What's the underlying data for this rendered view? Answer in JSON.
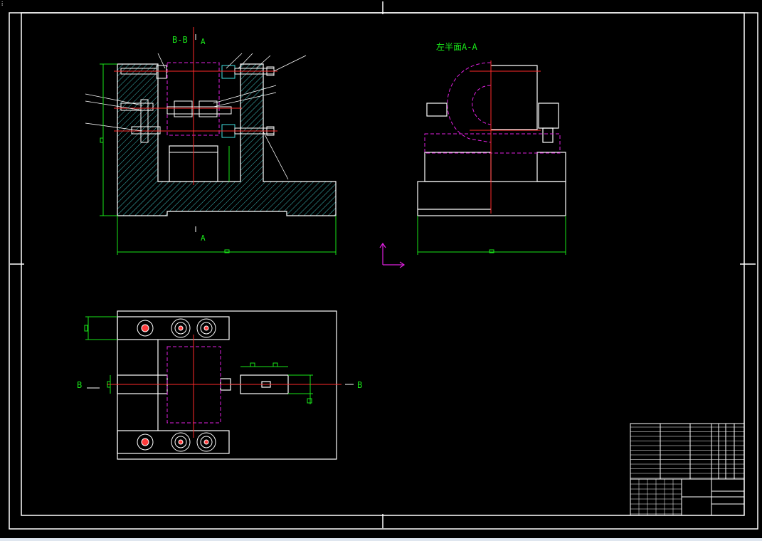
{
  "labels": {
    "section_bb": "B-B",
    "section_a_top": "A",
    "section_a_bottom": "A",
    "left_half_view": "左半面A-A",
    "cut_b_left": "B",
    "cut_b_right": "B"
  },
  "colors": {
    "background": "#000000",
    "outline": "#ffffff",
    "dimension": "#19e619",
    "centerline": "#ff2a2a",
    "hidden": "#e020e0",
    "hatch": "#3fbfbf"
  }
}
